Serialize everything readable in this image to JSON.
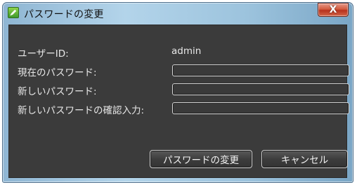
{
  "window": {
    "title": "パスワードの変更",
    "close_glyph": "X",
    "icon": "app-edit-icon"
  },
  "form": {
    "user_id_label": "ユーザーID:",
    "user_id_value": "admin",
    "current_password_label": "現在のパスワード:",
    "new_password_label": "新しいパスワード:",
    "confirm_password_label": "新しいパスワードの確認入力:",
    "current_password_value": "",
    "new_password_value": "",
    "confirm_password_value": ""
  },
  "buttons": {
    "change_password": "パスワードの変更",
    "cancel": "キャンセル"
  },
  "colors": {
    "client_bg": "#3b3b3b",
    "text": "#e8e8e8",
    "field_border": "#d6d6d6"
  }
}
